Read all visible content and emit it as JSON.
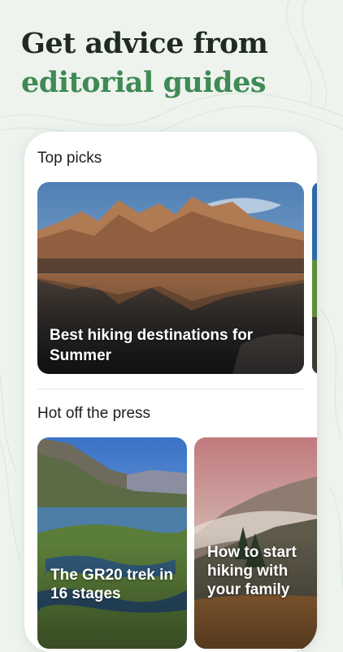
{
  "headline": {
    "line1": "Get advice from",
    "line2": "editorial guides"
  },
  "colors": {
    "accent": "#3f8a55",
    "headline_dark": "#1f2a22",
    "background": "#eef3ee"
  },
  "top_picks": {
    "title": "Top picks",
    "featured_card": {
      "title": "Best hiking destinations for Summer"
    }
  },
  "hot_off_press": {
    "title": "Hot off the press",
    "cards": [
      {
        "title": "The GR20 trek in 16 stages"
      },
      {
        "title": "How to start hiking with your family"
      }
    ]
  }
}
